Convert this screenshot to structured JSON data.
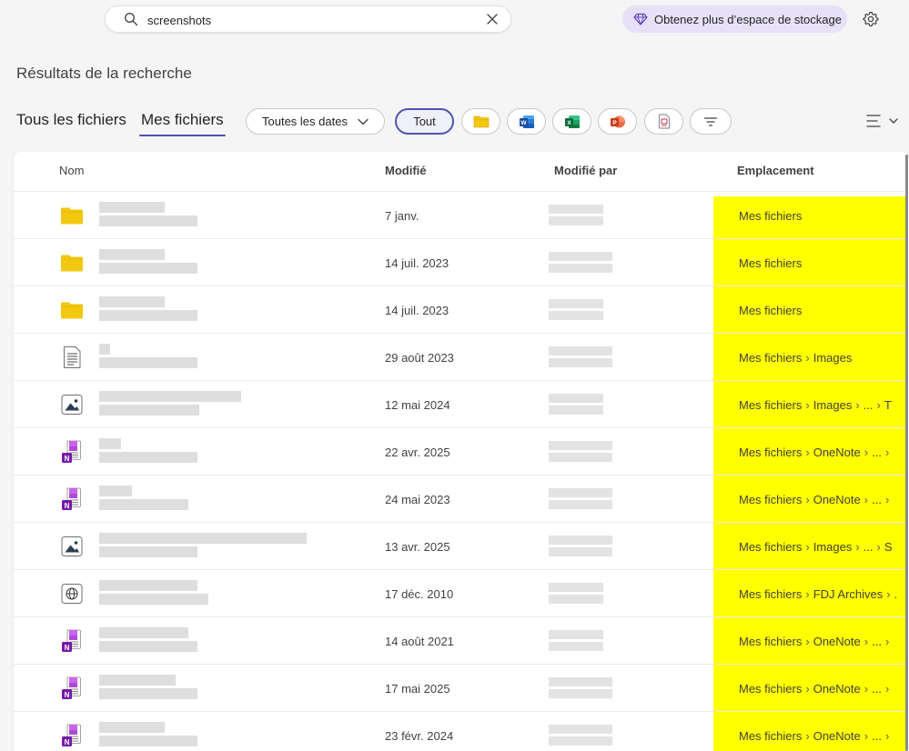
{
  "search": {
    "value": "screenshots"
  },
  "storage_button": {
    "label": "Obtenez plus d’espace de stockage"
  },
  "page": {
    "title": "Résultats de la recherche"
  },
  "tabs": [
    {
      "label": "Tous les fichiers",
      "selected": false
    },
    {
      "label": "Mes fichiers",
      "selected": true
    }
  ],
  "filters": {
    "dates_label": "Toutes les dates",
    "all_label": "Tout",
    "types": [
      "folder-icon",
      "word-icon",
      "excel-icon",
      "powerpoint-icon",
      "pdf-icon",
      "filter-icon"
    ]
  },
  "columns": {
    "name": "Nom",
    "modified": "Modifié",
    "modified_by": "Modifié par",
    "location": "Emplacement"
  },
  "colors": {
    "accent": "#4f52b2",
    "highlight": "#ffff00",
    "folder": "#f5c518",
    "onenote": "#7719aa"
  },
  "rows": [
    {
      "icon": "folder-icon",
      "date": "7 janv.",
      "location": [
        "Mes fichiers"
      ]
    },
    {
      "icon": "folder-icon",
      "date": "14 juil. 2023",
      "location": [
        "Mes fichiers"
      ]
    },
    {
      "icon": "folder-icon",
      "date": "14 juil. 2023",
      "location": [
        "Mes fichiers"
      ]
    },
    {
      "icon": "text-file-icon",
      "date": "29 août 2023",
      "location": [
        "Mes fichiers",
        "Images"
      ]
    },
    {
      "icon": "image-file-icon",
      "date": "12 mai 2024",
      "location": [
        "Mes fichiers",
        "Images",
        "...",
        "T"
      ]
    },
    {
      "icon": "onenote-icon",
      "date": "22 avr. 2025",
      "location": [
        "Mes fichiers",
        "OneNote",
        "...",
        ""
      ]
    },
    {
      "icon": "onenote-icon",
      "date": "24 mai 2023",
      "location": [
        "Mes fichiers",
        "OneNote",
        "...",
        ""
      ]
    },
    {
      "icon": "image-file-icon",
      "date": "13 avr. 2025",
      "location": [
        "Mes fichiers",
        "Images",
        "...",
        "S"
      ]
    },
    {
      "icon": "web-file-icon",
      "date": "17 déc. 2010",
      "location": [
        "Mes fichiers",
        "FDJ Archives",
        "."
      ]
    },
    {
      "icon": "onenote-icon",
      "date": "14 août 2021",
      "location": [
        "Mes fichiers",
        "OneNote",
        "...",
        ""
      ]
    },
    {
      "icon": "onenote-icon",
      "date": "17 mai 2025",
      "location": [
        "Mes fichiers",
        "OneNote",
        "...",
        ""
      ]
    },
    {
      "icon": "onenote-icon",
      "date": "23 févr. 2024",
      "location": [
        "Mes fichiers",
        "OneNote",
        "...",
        ""
      ]
    }
  ]
}
